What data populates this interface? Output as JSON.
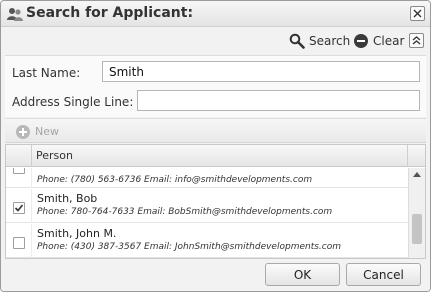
{
  "dialog": {
    "title": "Search for Applicant:"
  },
  "toolbar": {
    "search_label": "Search",
    "clear_label": "Clear"
  },
  "form": {
    "last_name_label": "Last Name:",
    "last_name_value": "Smith",
    "address_label": "Address Single Line:",
    "address_value": ""
  },
  "actions": {
    "new_label": "New"
  },
  "grid": {
    "column_person": "Person",
    "rows": [
      {
        "name": "",
        "detail": "Phone: (780) 563-6736  Email: info@smithdevelopments.com",
        "checked": false
      },
      {
        "name": "Smith, Bob",
        "detail": "Phone: 780-764-7633  Email: BobSmith@smithdevelopments.com",
        "checked": true
      },
      {
        "name": "Smith, John M.",
        "detail": "Phone: (430) 387-3567   Email: JohnSmith@smithdevelopments.com",
        "checked": false
      }
    ]
  },
  "footer": {
    "ok_label": "OK",
    "cancel_label": "Cancel"
  },
  "icons": {
    "title": "users-icon",
    "close": "close-icon",
    "search": "magnifier-icon",
    "clear": "minus-circle-icon",
    "collapse": "double-chevron-up-icon",
    "new": "plus-circle-icon",
    "check": "checkmark-icon"
  }
}
